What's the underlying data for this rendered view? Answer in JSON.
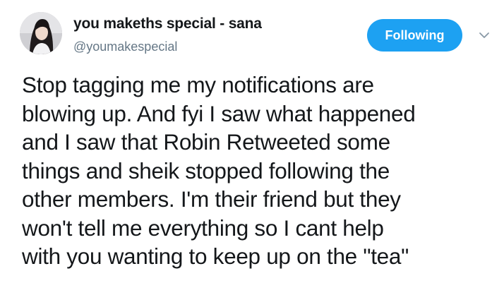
{
  "author": {
    "display_name": "you makeths special - sana",
    "handle": "@youmakespecial",
    "avatar_icon": "profile-photo"
  },
  "follow_button": {
    "label": "Following",
    "color": "#1da1f2"
  },
  "menu": {
    "icon": "chevron-down-icon"
  },
  "tweet": {
    "lines": [
      "Stop tagging me my notifications are",
      "blowing up. And fyi I saw what happened",
      "and I saw that Robin Retweeted some",
      "things and sheik stopped following the",
      "other members. I'm their friend but they",
      "won't tell me everything so I cant help",
      "with you wanting to keep up on the \"tea\""
    ]
  }
}
